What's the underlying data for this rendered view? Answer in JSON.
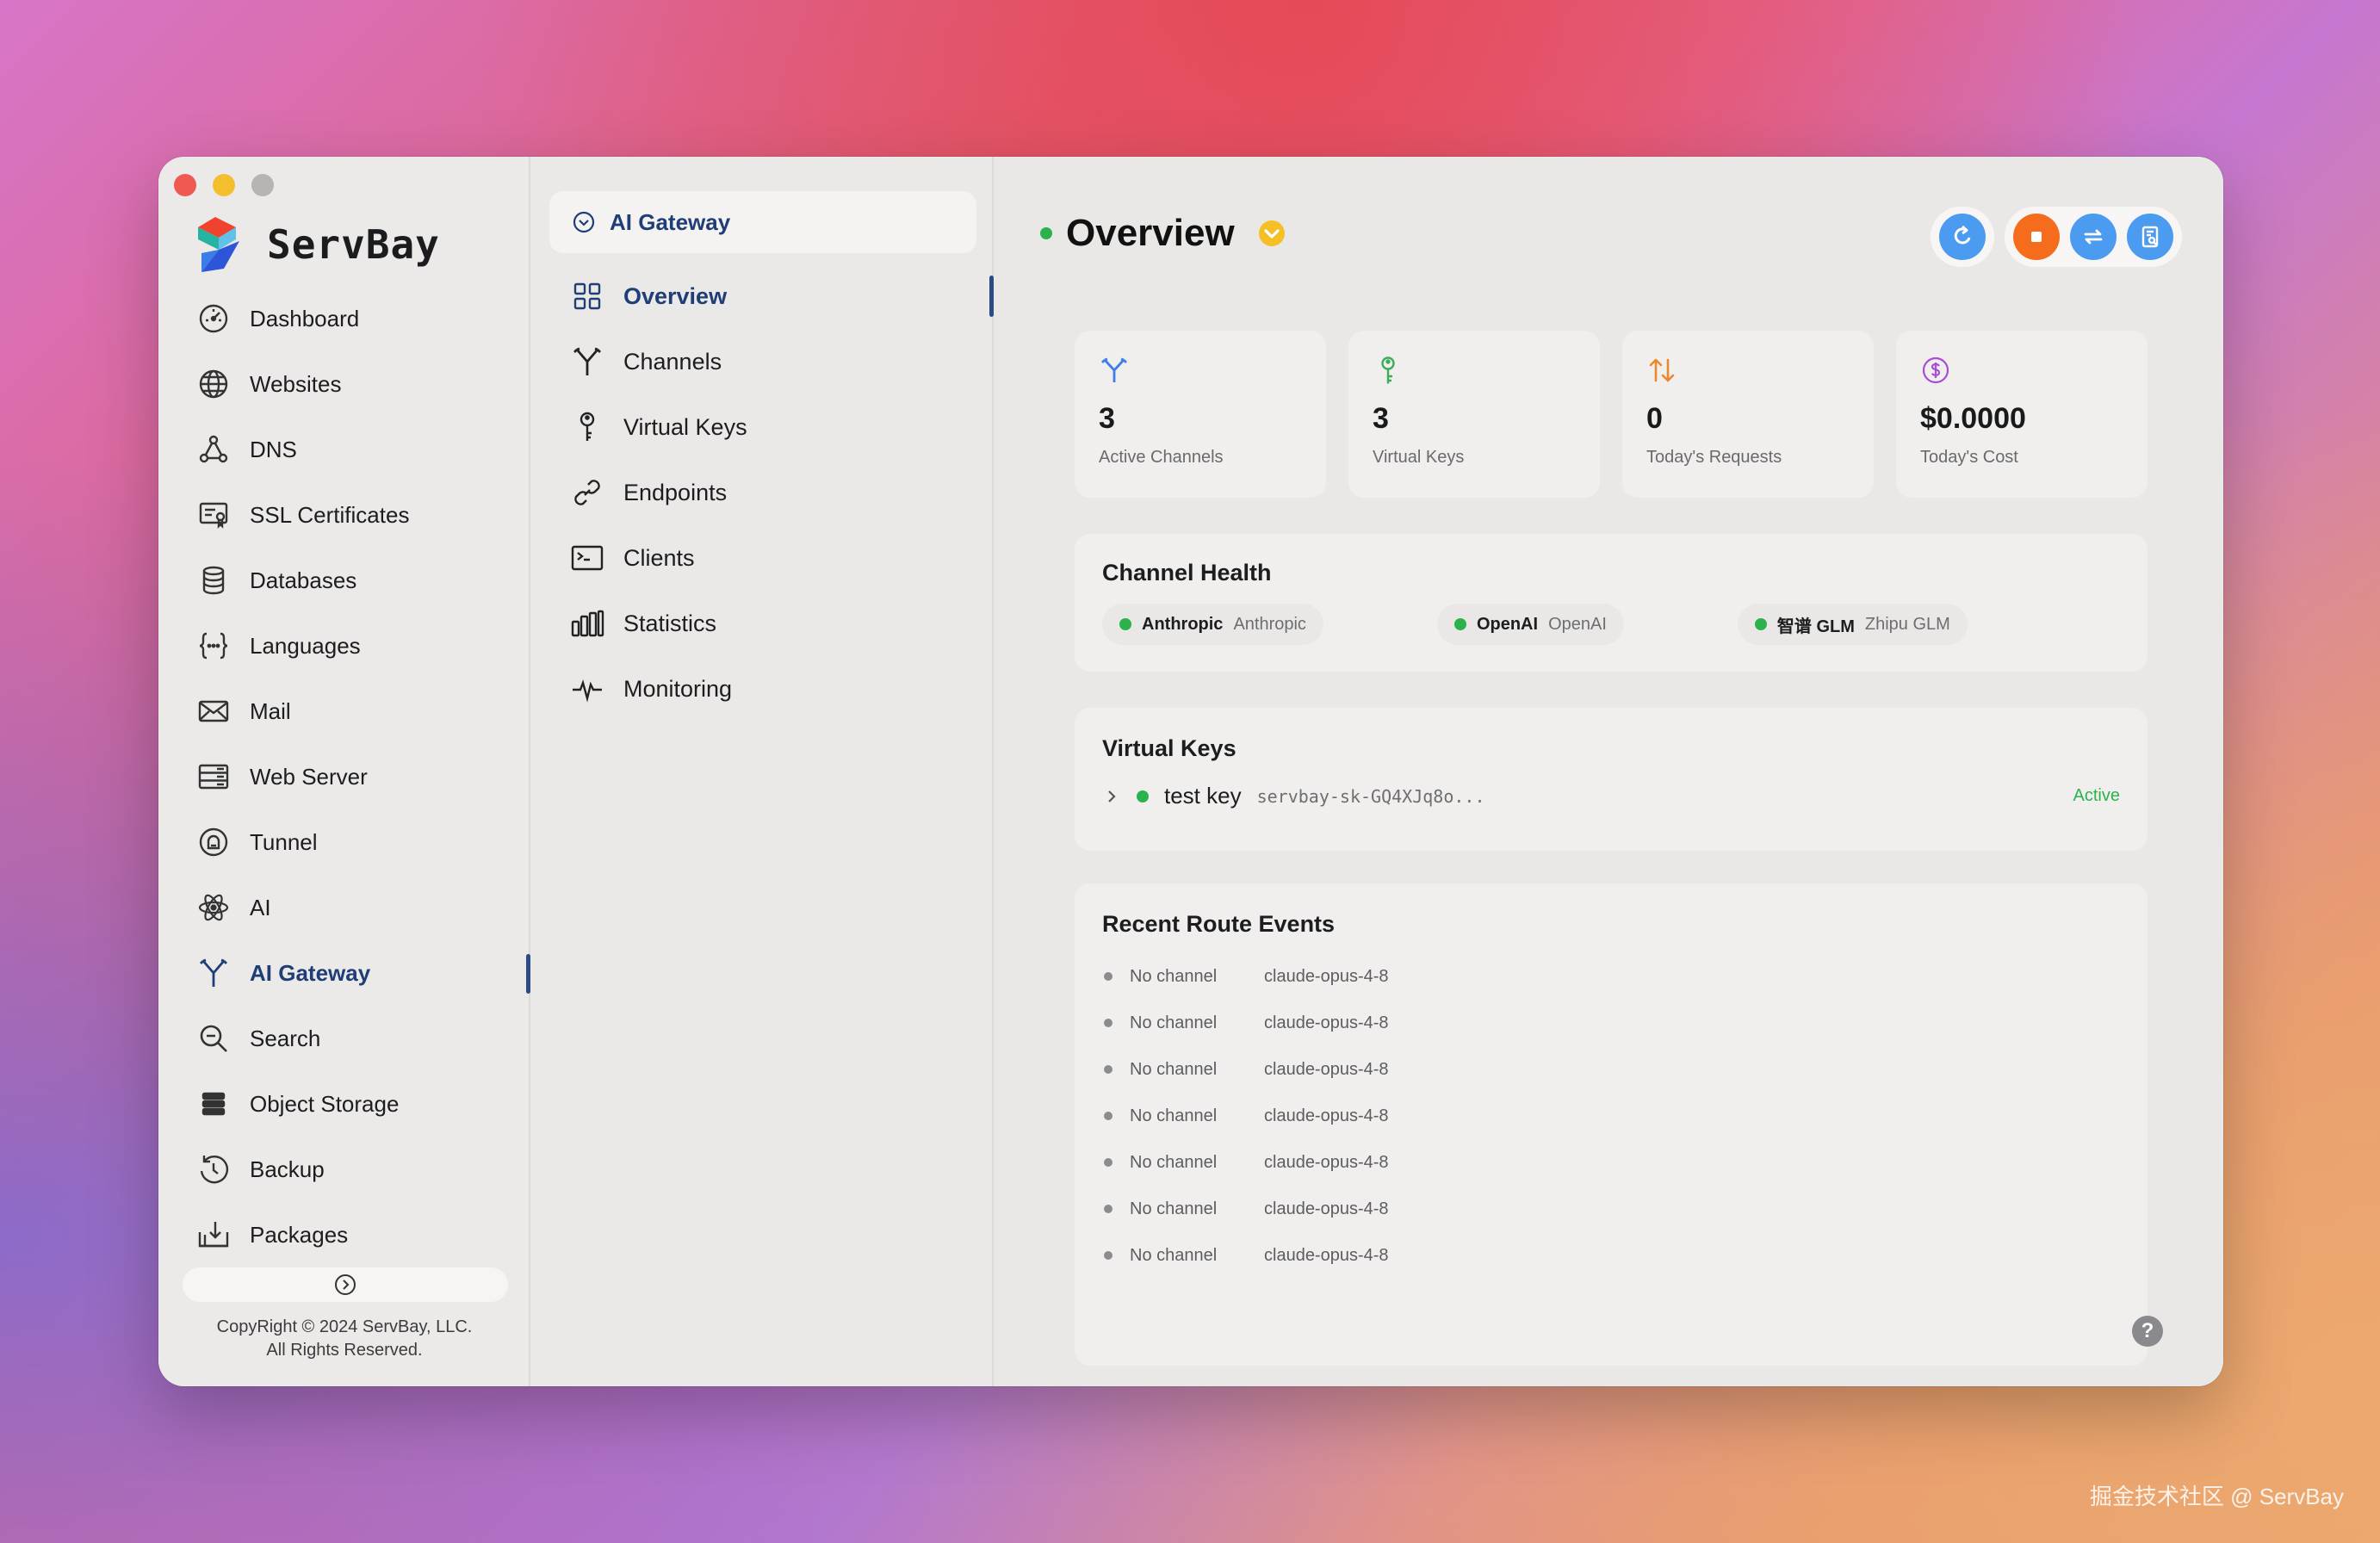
{
  "app": {
    "name": "ServBay",
    "copyright_line1": "CopyRight © 2024 ServBay, LLC.",
    "copyright_line2": "All Rights Reserved."
  },
  "sidebar": {
    "items": [
      {
        "label": "Dashboard",
        "icon": "dashboard-icon"
      },
      {
        "label": "Websites",
        "icon": "globe-icon"
      },
      {
        "label": "DNS",
        "icon": "dns-icon"
      },
      {
        "label": "SSL Certificates",
        "icon": "certificate-icon"
      },
      {
        "label": "Databases",
        "icon": "database-icon"
      },
      {
        "label": "Languages",
        "icon": "code-braces-icon"
      },
      {
        "label": "Mail",
        "icon": "mail-icon"
      },
      {
        "label": "Web Server",
        "icon": "server-icon"
      },
      {
        "label": "Tunnel",
        "icon": "tunnel-icon"
      },
      {
        "label": "AI",
        "icon": "atom-icon"
      },
      {
        "label": "AI Gateway",
        "icon": "gateway-icon",
        "active": true
      },
      {
        "label": "Search",
        "icon": "search-icon"
      },
      {
        "label": "Object Storage",
        "icon": "storage-icon"
      },
      {
        "label": "Backup",
        "icon": "backup-icon"
      },
      {
        "label": "Packages",
        "icon": "packages-icon"
      }
    ]
  },
  "submenu": {
    "header": "AI Gateway",
    "items": [
      {
        "label": "Overview",
        "icon": "grid-icon",
        "active": true
      },
      {
        "label": "Channels",
        "icon": "channels-icon"
      },
      {
        "label": "Virtual Keys",
        "icon": "key-icon"
      },
      {
        "label": "Endpoints",
        "icon": "link-icon"
      },
      {
        "label": "Clients",
        "icon": "terminal-icon"
      },
      {
        "label": "Statistics",
        "icon": "bar-chart-icon"
      },
      {
        "label": "Monitoring",
        "icon": "pulse-icon"
      }
    ]
  },
  "main": {
    "title": "Overview",
    "stats": [
      {
        "value": "3",
        "label": "Active Channels",
        "icon": "channels-icon",
        "color": "#3f7de8"
      },
      {
        "value": "3",
        "label": "Virtual Keys",
        "icon": "key-icon",
        "color": "#3cae5a"
      },
      {
        "value": "0",
        "label": "Today's Requests",
        "icon": "arrows-updown-icon",
        "color": "#e8892f"
      },
      {
        "value": "$0.0000",
        "label": "Today's Cost",
        "icon": "dollar-icon",
        "color": "#a64ed6"
      }
    ],
    "channel_health": {
      "title": "Channel Health",
      "channels": [
        {
          "name": "Anthropic",
          "provider": "Anthropic"
        },
        {
          "name": "OpenAI",
          "provider": "OpenAI"
        },
        {
          "name": "智谱 GLM",
          "provider": "Zhipu GLM"
        }
      ]
    },
    "virtual_keys": {
      "title": "Virtual Keys",
      "items": [
        {
          "name": "test key",
          "key": "servbay-sk-GQ4XJq8o...",
          "status": "Active"
        }
      ]
    },
    "route_events": {
      "title": "Recent Route Events",
      "items": [
        {
          "channel": "No channel",
          "model": "claude-opus-4-8"
        },
        {
          "channel": "No channel",
          "model": "claude-opus-4-8"
        },
        {
          "channel": "No channel",
          "model": "claude-opus-4-8"
        },
        {
          "channel": "No channel",
          "model": "claude-opus-4-8"
        },
        {
          "channel": "No channel",
          "model": "claude-opus-4-8"
        },
        {
          "channel": "No channel",
          "model": "claude-opus-4-8"
        },
        {
          "channel": "No channel",
          "model": "claude-opus-4-8"
        }
      ]
    }
  },
  "help_label": "?",
  "watermark": "掘金技术社区 @ ServBay",
  "colors": {
    "accent": "#1f3e77",
    "status_green": "#2bb24c",
    "stop_orange": "#f46c1c",
    "button_blue": "#4b9bf0"
  }
}
